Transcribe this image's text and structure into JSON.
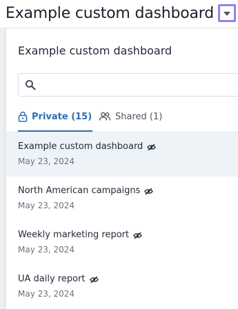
{
  "header": {
    "title": "Example custom dashboard"
  },
  "panel": {
    "title": "Example custom dashboard",
    "search": {
      "value": "",
      "placeholder": ""
    },
    "tabs": [
      {
        "label": "Private (15)",
        "active": true,
        "icon": "lock-icon"
      },
      {
        "label": "Shared (1)",
        "active": false,
        "icon": "users-icon"
      }
    ],
    "items": [
      {
        "name": "Example custom dashboard",
        "date": "May 23, 2024",
        "selected": true,
        "icon": "eye-off-icon"
      },
      {
        "name": "North American campaigns",
        "date": "May 23, 2024",
        "selected": false,
        "icon": "eye-off-icon"
      },
      {
        "name": "Weekly marketing report",
        "date": "May 23, 2024",
        "selected": false,
        "icon": "eye-off-icon"
      },
      {
        "name": "UA daily report",
        "date": "May 23, 2024",
        "selected": false,
        "icon": "eye-off-icon"
      }
    ]
  },
  "colors": {
    "accent": "#2c6db3",
    "toggle_highlight": "#9b7cf2",
    "selected_row": "#eef3f8"
  }
}
